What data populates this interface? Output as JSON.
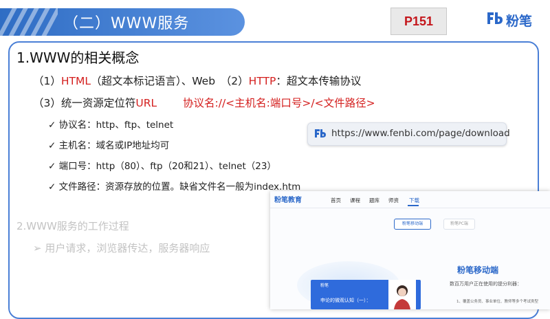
{
  "header": {
    "title": "（二）WWW服务",
    "page_label": "P151",
    "logo_text": "粉笔",
    "accent": "#2f6dc4"
  },
  "section1": {
    "heading": "1.WWW的相关概念",
    "line1": {
      "a": "（1）",
      "b": "HTML",
      "c": "（超文本标记语言）、Web　（2）",
      "d": "HTTP",
      "e": "：超文本传输协议"
    },
    "line2": {
      "a": "（3）统一资源定位符",
      "b": "URL",
      "c": "协议名://<主机名:端口号>/<文件路径>"
    },
    "checks": [
      "协议名：http、ftp、telnet",
      "主机名：域名或IP地址均可",
      "端口号：http（80）、ftp（20和21）、telnet（23）",
      "文件路径：资源存放的位置。缺省文件名一般为index.htm"
    ]
  },
  "url_bar": {
    "url": "https://www.fenbi.com/page/download"
  },
  "section2": {
    "heading": "2.WWW服务的工作过程",
    "bullet": "用户请求，浏览器传达，服务器响应"
  },
  "embedded_site": {
    "logo": "粉笔教育",
    "nav": [
      "首页",
      "课程",
      "题库",
      "师资",
      "下载"
    ],
    "buttons": [
      "粉笔移动端",
      "粉笔PC端"
    ],
    "promo_title": "粉笔移动端",
    "promo_sub": "数百万用户正在使用的提分利器：",
    "promo_item": "1、覆盖公务员、事业单位、教师等多个考试类型",
    "card_logo": "粉笔",
    "card_text": "申论的微观认知（一）："
  },
  "icons": [
    "check-icon",
    "arrow-right-icon",
    "fenbi-logo-icon"
  ]
}
